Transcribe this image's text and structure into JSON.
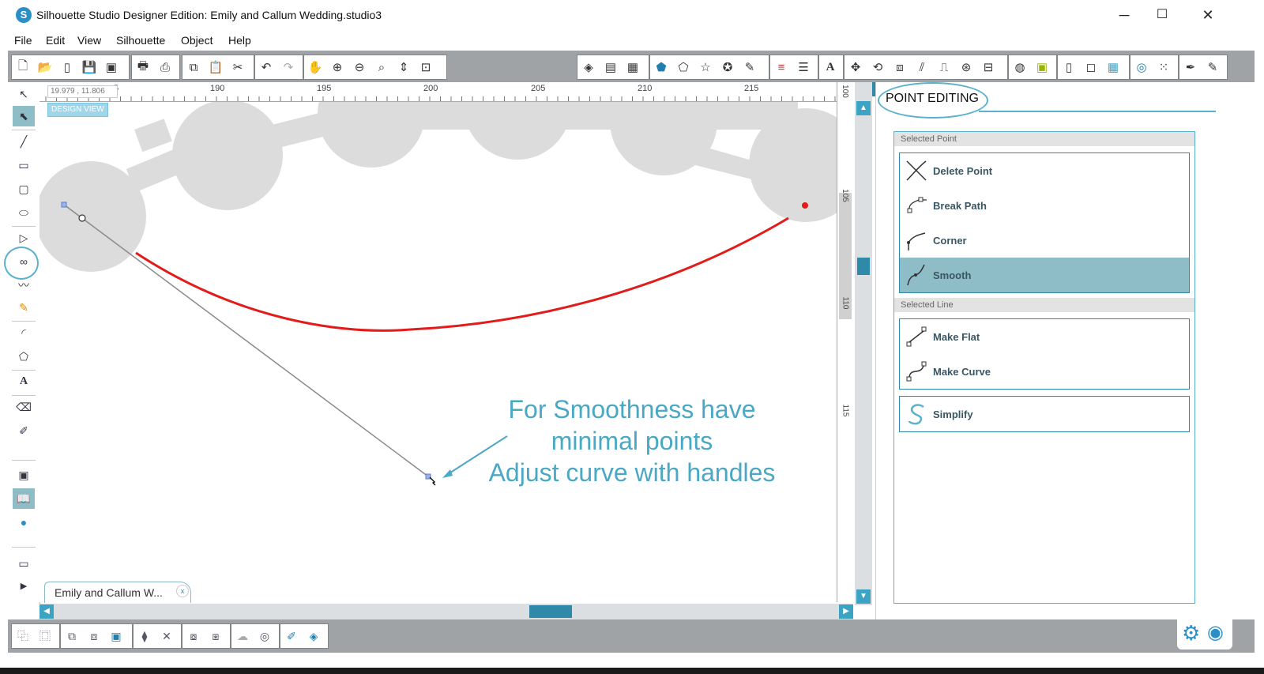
{
  "window": {
    "title": "Silhouette Studio Designer Edition: Emily and Callum Wedding.studio3",
    "logo_glyph": "S",
    "minimize_glyph": "─",
    "maximize_glyph": "☐",
    "close_glyph": "✕"
  },
  "menu": [
    "File",
    "Edit",
    "View",
    "Silhouette",
    "Object",
    "Help"
  ],
  "canvas": {
    "coordinates": "19.979 , 11.806",
    "view_label": "DESIGN VIEW",
    "ruler_top": [
      "5",
      "190",
      "195",
      "200",
      "205",
      "210",
      "215"
    ],
    "ruler_right": [
      "100",
      "105",
      "110",
      "115"
    ],
    "annotation": [
      "For Smoothness have",
      "minimal points",
      "Adjust curve with handles"
    ],
    "curve_color": "#e21b1b",
    "shape_color": "#dcdcdc"
  },
  "document_tab": {
    "label": "Emily and Callum W...",
    "close_glyph": "x"
  },
  "panel": {
    "title": "POINT EDITING",
    "selected_point_header": "Selected Point",
    "selected_point_options": [
      {
        "label": "Delete Point",
        "icon": "delete-point-icon"
      },
      {
        "label": "Break Path",
        "icon": "break-path-icon"
      },
      {
        "label": "Corner",
        "icon": "corner-icon"
      },
      {
        "label": "Smooth",
        "icon": "smooth-icon",
        "selected": true
      }
    ],
    "selected_line_header": "Selected Line",
    "selected_line_options": [
      {
        "label": "Make Flat",
        "icon": "make-flat-icon"
      },
      {
        "label": "Make Curve",
        "icon": "make-curve-icon"
      }
    ],
    "simplify_label": "Simplify"
  },
  "colors": {
    "accent": "#2e8aa8",
    "accent_light": "#5ab1cc",
    "selected_bg": "#8fbdc7",
    "toolbar_bg": "#9fa3a6"
  }
}
